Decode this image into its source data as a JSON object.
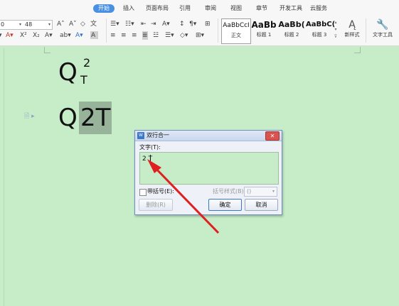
{
  "ribbon": {
    "tabs": [
      "开始",
      "插入",
      "页面布局",
      "引用",
      "审阅",
      "视图",
      "章节",
      "开发工具",
      "云服务"
    ],
    "active_tab": "开始",
    "font_name_partial": "0",
    "font_size": "48",
    "styles": [
      {
        "sample": "AaBbCcI",
        "label": "正文"
      },
      {
        "sample": "AaBb",
        "label": "标题 1"
      },
      {
        "sample": "AaBb(",
        "label": "标题 2"
      },
      {
        "sample": "AaBbC(",
        "label": "标题 3"
      }
    ],
    "new_style_label": "新样式",
    "text_tools_label": "文字工具"
  },
  "document": {
    "line1_base": "Q",
    "line1_sup": "2",
    "line1_sub": "T",
    "line2_prefix": "Q",
    "line2_selected": "2T"
  },
  "dialog": {
    "title": "双行合一",
    "text_label": "文字(T):",
    "text_value": "2 T",
    "bracket_label": "带括号(E):",
    "bracket_style_label": "括号样式(B):",
    "bracket_style_value": "()",
    "delete_label": "删除(R)",
    "ok_label": "确定",
    "cancel_label": "取消"
  },
  "colors": {
    "doc_background": "#c6ecc8",
    "selection": "#97b49a",
    "active_tab": "#4a90e2",
    "arrow": "#e02020"
  }
}
